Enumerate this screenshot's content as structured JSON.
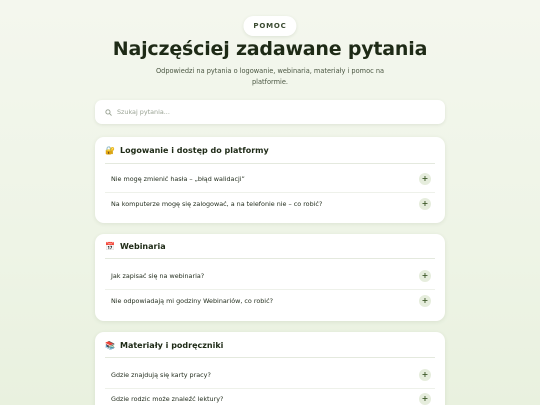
{
  "header": {
    "badge": "POMOC",
    "title": "Najczęściej zadawane pytania",
    "subtitle": "Odpowiedzi na pytania o logowanie, webinaria, materiały i pomoc na platformie."
  },
  "search": {
    "placeholder": "Szukaj pytania..."
  },
  "sections": [
    {
      "icon": "🔐",
      "icon_name": "lock-key-icon",
      "title": "Logowanie i dostęp do platformy",
      "items": [
        "Nie mogę zmienić hasła – „błąd walidacji”",
        "Na komputerze mogę się zalogować, a na telefonie nie – co robić?"
      ]
    },
    {
      "icon": "📅",
      "icon_name": "calendar-icon",
      "title": "Webinaria",
      "items": [
        "Jak zapisać się na webinaria?",
        "Nie odpowiadają mi godziny Webinariów, co robić?"
      ]
    },
    {
      "icon": "📚",
      "icon_name": "books-icon",
      "title": "Materiały i podręczniki",
      "items": [
        "Gdzie znajdują się karty pracy?",
        "Gdzie rodzic może znaleźć lektury?"
      ]
    }
  ],
  "expand_glyph": "+",
  "colors": {
    "accent": "#3f5a2b",
    "plus_bg": "#e6eddd",
    "background": "#eef4e6"
  }
}
